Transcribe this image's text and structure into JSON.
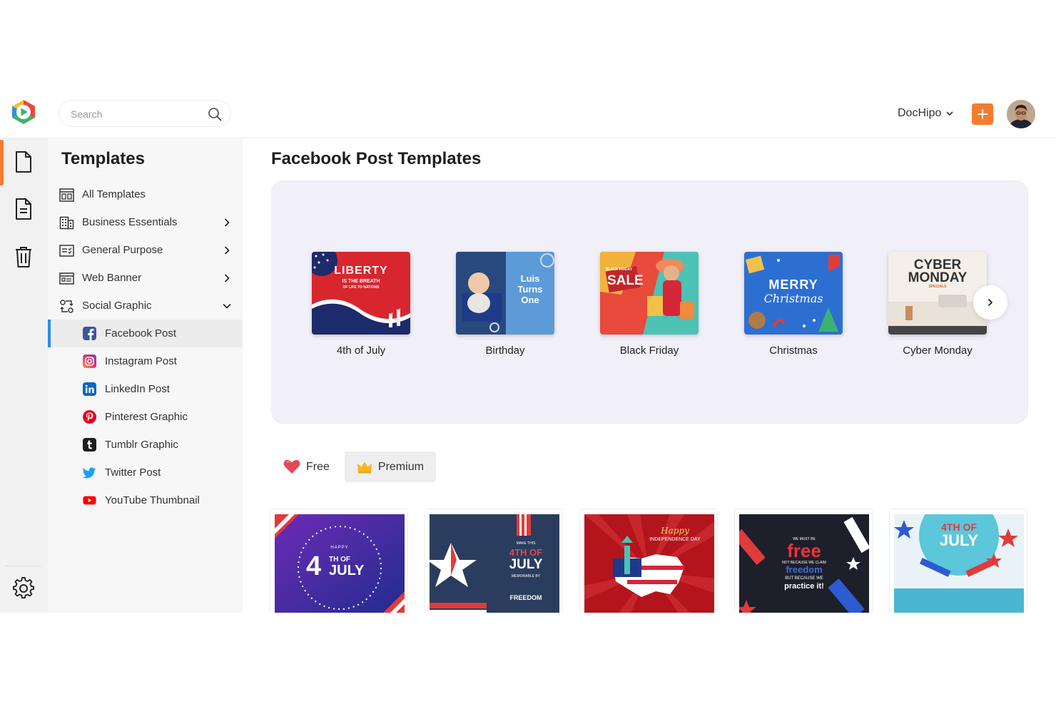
{
  "topbar": {
    "search_placeholder": "Search",
    "account_name": "DocHipo"
  },
  "rail": [
    {
      "icon": "document-icon",
      "active": true
    },
    {
      "icon": "file-text-icon",
      "active": false
    },
    {
      "icon": "trash-icon",
      "active": false
    },
    {
      "icon": "settings-icon",
      "active": false
    }
  ],
  "sidebar": {
    "title": "Templates",
    "items": [
      {
        "label": "All Templates",
        "icon": "all-templates-icon",
        "chevron": ""
      },
      {
        "label": "Business Essentials",
        "icon": "building-icon",
        "chevron": "right"
      },
      {
        "label": "General Purpose",
        "icon": "checklist-icon",
        "chevron": "right"
      },
      {
        "label": "Web Banner",
        "icon": "web-banner-icon",
        "chevron": "right"
      },
      {
        "label": "Social Graphic",
        "icon": "share-icon",
        "chevron": "down"
      }
    ],
    "social": [
      {
        "label": "Facebook Post",
        "icon": "facebook-icon",
        "color": "#3b5998",
        "active": true
      },
      {
        "label": "Instagram Post",
        "icon": "instagram-icon",
        "color": "#e1306c",
        "active": false
      },
      {
        "label": "LinkedIn Post",
        "icon": "linkedin-icon",
        "color": "#0a66c2",
        "active": false
      },
      {
        "label": "Pinterest Graphic",
        "icon": "pinterest-icon",
        "color": "#e60023",
        "active": false
      },
      {
        "label": "Tumblr Graphic",
        "icon": "tumblr-icon",
        "color": "#1d1d1d",
        "active": false
      },
      {
        "label": "Twitter Post",
        "icon": "twitter-icon",
        "color": "#1da1f2",
        "active": false
      },
      {
        "label": "YouTube Thumbnail",
        "icon": "youtube-icon",
        "color": "#ff0000",
        "active": false
      }
    ]
  },
  "main": {
    "title": "Facebook Post Templates",
    "occasions": [
      {
        "label": "4th of July",
        "thumb_lines": [
          "LIBERTY",
          "IS THE BREATH",
          "OF LIFE TO NATIONS"
        ]
      },
      {
        "label": "Birthday",
        "thumb_lines": [
          "Luis",
          "Turns",
          "One"
        ]
      },
      {
        "label": "Black Friday",
        "thumb_lines": [
          "BLACK FRIDAY",
          "SALE"
        ]
      },
      {
        "label": "Christmas",
        "thumb_lines": [
          "MERRY",
          "Christmas"
        ]
      },
      {
        "label": "Cyber Monday",
        "thumb_lines": [
          "CYBER",
          "MONDAY",
          "SPECIALS"
        ]
      }
    ],
    "filters": [
      {
        "label": "Free",
        "icon": "heart-icon",
        "selected": false
      },
      {
        "label": "Premium",
        "icon": "crown-icon",
        "selected": true
      }
    ],
    "templates": [
      {
        "lines": [
          "HAPPY",
          "4",
          "TH OF",
          "JULY"
        ]
      },
      {
        "lines": [
          "MAKE THIS",
          "4TH OF",
          "JULY",
          "MEMORABLE BY",
          "FREEDOM"
        ]
      },
      {
        "lines": [
          "Happy",
          "INDEPENDENCE DAY"
        ]
      },
      {
        "lines": [
          "WE MUST BE",
          "free",
          "NOT BECAUSE WE CLAIM",
          "freedom",
          "BUT BECAUSE WE",
          "practice it!"
        ]
      },
      {
        "lines": [
          "4TH OF",
          "JULY"
        ]
      }
    ]
  },
  "colors": {
    "accent": "#f47c2d",
    "active_blue": "#2a8ce6",
    "carousel_bg": "#f1eff8"
  }
}
